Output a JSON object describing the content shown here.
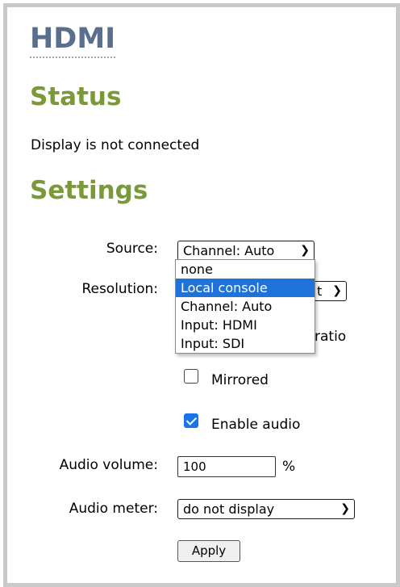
{
  "title": "HDMI",
  "status": {
    "heading": "Status",
    "text": "Display is not connected"
  },
  "settings": {
    "heading": "Settings",
    "source_label": "Source:",
    "source_value": "Channel: Auto",
    "source_options": [
      "none",
      "Local console",
      "Channel: Auto",
      "Input: HDMI",
      "Input: SDI"
    ],
    "source_highlighted": "Local console",
    "resolution_label": "Resolution:",
    "resolution_visible_tail": "t",
    "aspect_ratio_visible_text": "ratio",
    "mirrored_label": "Mirrored",
    "mirrored_checked": false,
    "enable_audio_label": "Enable audio",
    "enable_audio_checked": true,
    "audio_volume_label": "Audio volume:",
    "audio_volume_value": "100",
    "audio_volume_unit": "%",
    "audio_meter_label": "Audio meter:",
    "audio_meter_value": "do not display",
    "apply_label": "Apply"
  },
  "colors": {
    "title": "#5a6e8e",
    "heading": "#7a9a3a",
    "highlight": "#1f72d8",
    "checkbox": "#1a73e8"
  }
}
